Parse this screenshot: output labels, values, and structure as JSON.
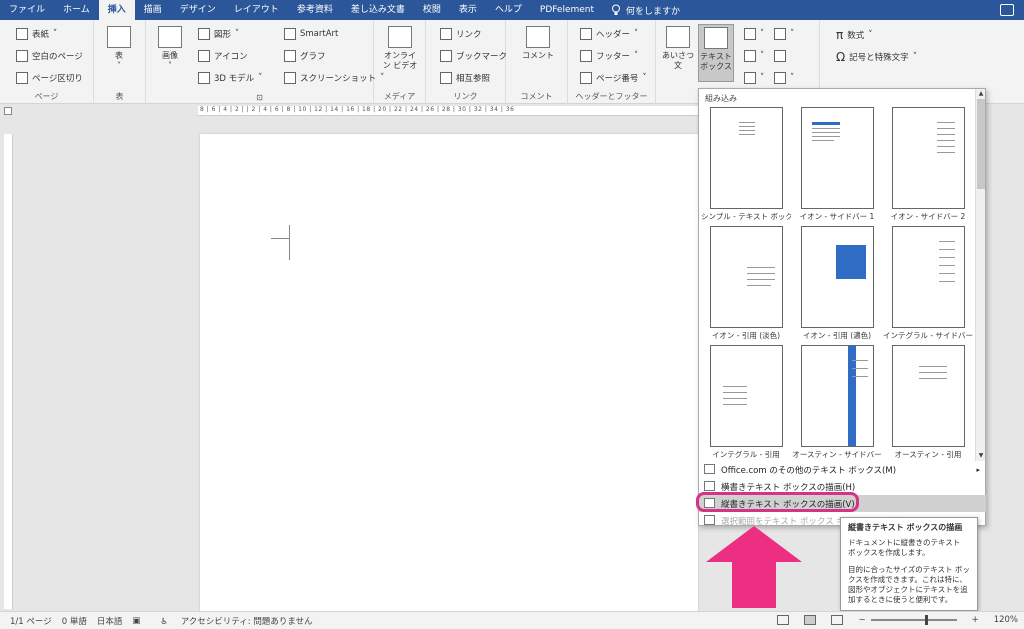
{
  "tabs": [
    "ファイル",
    "ホーム",
    "挿入",
    "描画",
    "デザイン",
    "レイアウト",
    "参考資料",
    "差し込み文書",
    "校閲",
    "表示",
    "ヘルプ",
    "PDFelement"
  ],
  "tell_me": "何をしますか",
  "ribbon": {
    "pages": {
      "cover": "表紙",
      "blank": "空白のページ",
      "break": "ページ区切り",
      "label": "ページ"
    },
    "table": {
      "btn": "表",
      "label": "表"
    },
    "illus": {
      "pictures": "画像",
      "shapes": "図形",
      "icons": "アイコン",
      "model3d": "3D モデル",
      "smartart": "SmartArt",
      "chart": "グラフ",
      "screenshot": "スクリーンショット"
    },
    "media": {
      "video": "オンライン ビデオ",
      "label": "メディア"
    },
    "links": {
      "link": "リンク",
      "bookmark": "ブックマーク",
      "xref": "相互参照",
      "label": "リンク"
    },
    "comments": {
      "comment": "コメント",
      "label": "コメント"
    },
    "hf": {
      "header": "ヘッダー",
      "footer": "フッター",
      "pagenum": "ページ番号",
      "label": "ヘッダーとフッター"
    },
    "text": {
      "greeting": "あいさつ 文",
      "textbox": "テキスト ボックス"
    },
    "symbols": {
      "equation": "数式",
      "symbol": "記号と特殊文字"
    }
  },
  "panel": {
    "header": "組み込み",
    "thumbs": [
      "シンプル - テキスト ボックス",
      "イオン - サイドバー 1",
      "イオン - サイドバー 2",
      "イオン - 引用 (淡色)",
      "イオン - 引用 (濃色)",
      "インテグラル - サイドバー",
      "インテグラル - 引用",
      "オースティン - サイドバー",
      "オースティン - 引用"
    ],
    "menu": [
      "Office.com のその他のテキスト ボックス(M)",
      "横書きテキスト ボックスの描画(H)",
      "縦書きテキスト ボックスの描画(V)",
      "選択範囲をテキスト ボックス ギャラリーに保存(S)"
    ]
  },
  "tooltip": {
    "title": "縦書きテキスト ボックスの描画",
    "line1": "ドキュメントに縦書きのテキスト ボックスを作成します。",
    "line2": "目的に合ったサイズのテキスト ボックスを作成できます。これは特に、図形やオブジェクトにテキストを追加するときに使うと便利です。"
  },
  "status": {
    "page": "1/1 ページ",
    "words": "0 単語",
    "lang": "日本語",
    "access": "アクセシビリティ: 問題ありません",
    "zoom": "120%"
  },
  "ruler": "8 | 6 | 4 | 2 | | 2 | 4 | 6 | 8 | 10 | 12 | 14 | 16 | 18 | 20 | 22 | 24 | 26 | 28 | 30 | 32 | 34 | 36",
  "colors": {
    "tab_bar": "#2b579a",
    "highlight_ring": "#d63384",
    "arrow": "#ec2f83"
  }
}
